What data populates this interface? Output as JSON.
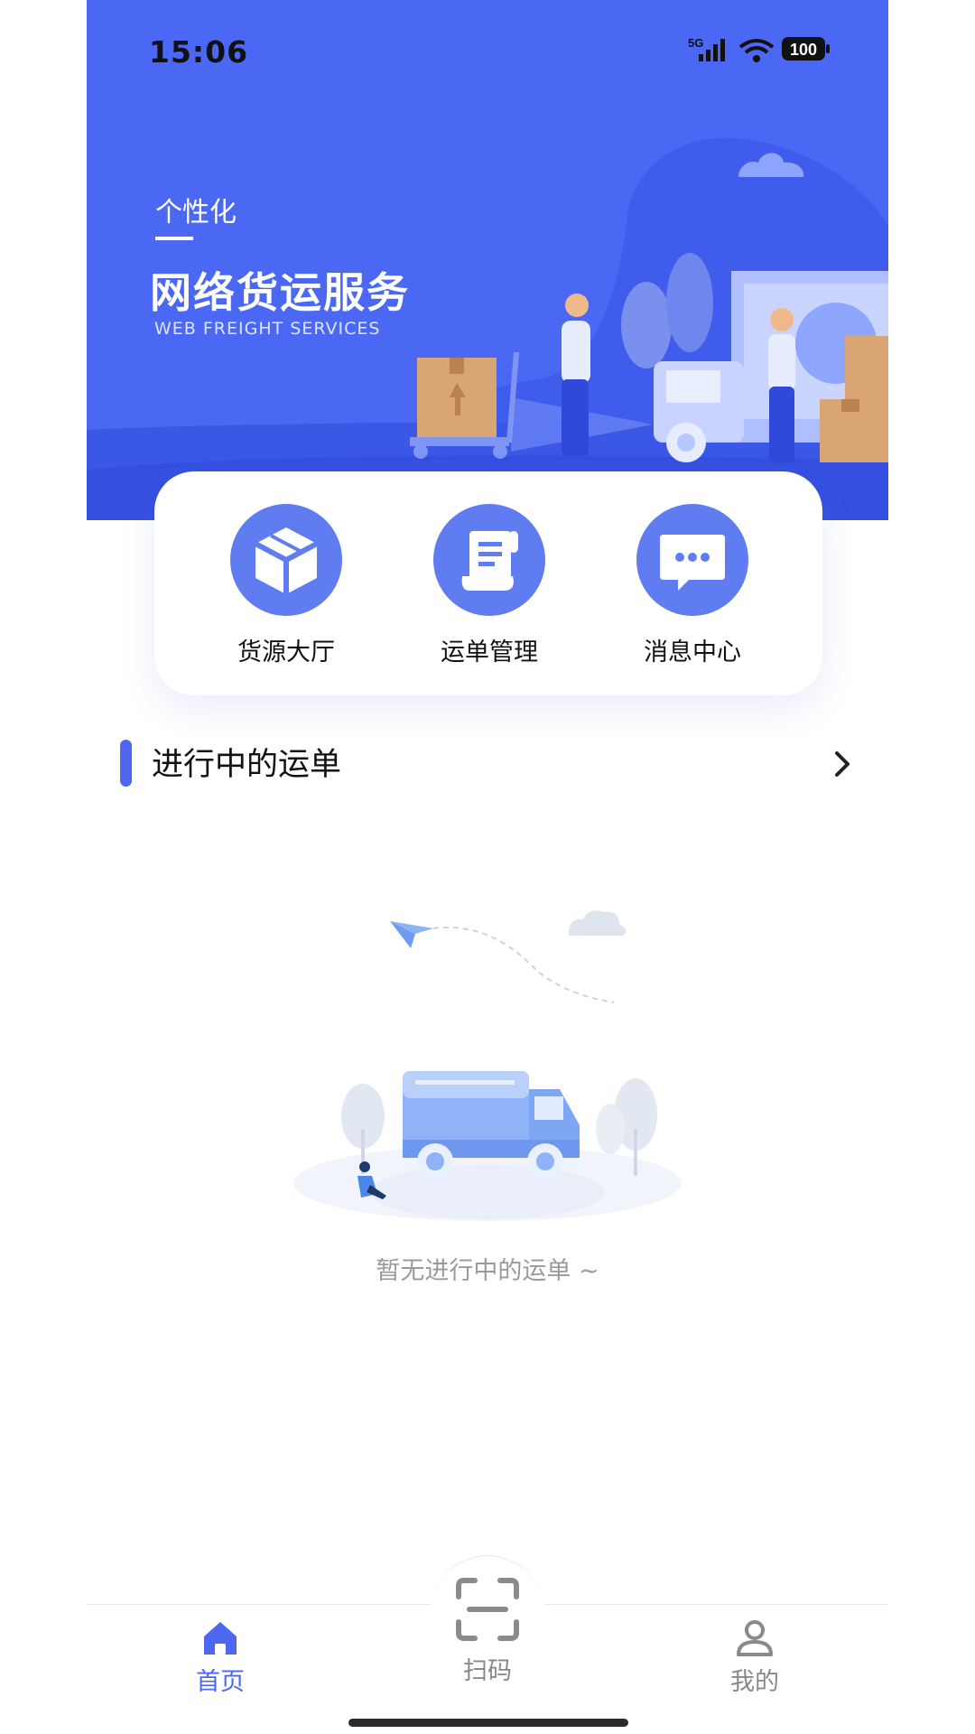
{
  "status_bar": {
    "time": "15:06",
    "network": "5G",
    "battery": "100"
  },
  "hero": {
    "subtitle": "个性化",
    "title": "网络货运服务",
    "title_en": "WEB FREIGHT SERVICES"
  },
  "functions": [
    {
      "label": "货源大厅",
      "icon": "cube-icon"
    },
    {
      "label": "运单管理",
      "icon": "waybill-scroll-icon"
    },
    {
      "label": "消息中心",
      "icon": "chat-bubble-icon"
    }
  ],
  "section": {
    "title": "进行中的运单"
  },
  "empty_state": {
    "text": "暂无进行中的运单 ~"
  },
  "tabbar": {
    "tabs": [
      {
        "label": "首页",
        "icon": "home-icon",
        "active": true
      },
      {
        "label": "扫码",
        "icon": "scan-icon",
        "active": false
      },
      {
        "label": "我的",
        "icon": "user-icon",
        "active": false
      }
    ]
  },
  "colors": {
    "primary": "#4e67f0",
    "hero_bg": "#4a68f3",
    "icon_circle": "#5f7cf0",
    "inactive_tab": "#888888"
  }
}
